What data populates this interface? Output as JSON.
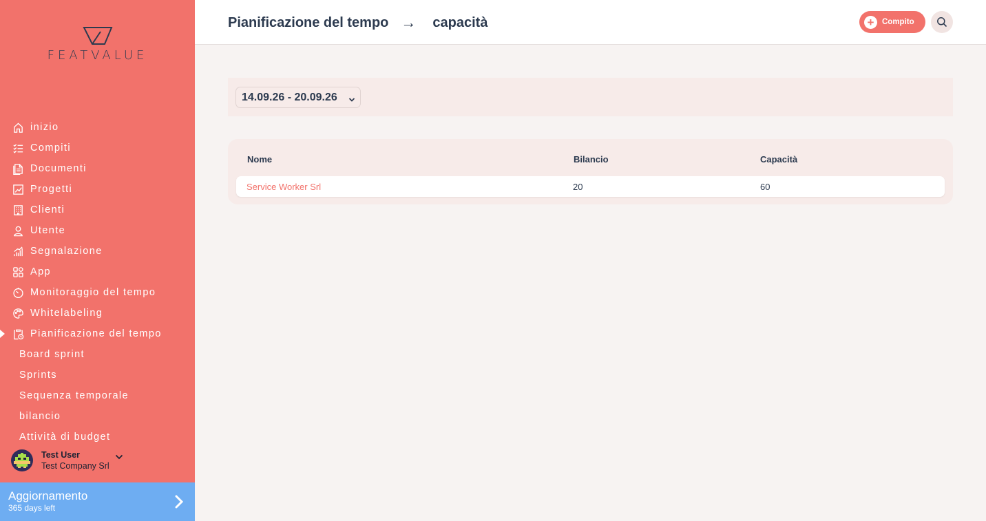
{
  "app": {
    "logo_text": "FEATVALUE"
  },
  "sidebar": {
    "items": [
      {
        "label": "inizio",
        "icon": "home-icon"
      },
      {
        "label": "Compiti",
        "icon": "checklist-icon"
      },
      {
        "label": "Documenti",
        "icon": "document-icon"
      },
      {
        "label": "Progetti",
        "icon": "chart-board-icon"
      },
      {
        "label": "Clienti",
        "icon": "building-icon"
      },
      {
        "label": "Utente",
        "icon": "user-icon"
      },
      {
        "label": "Segnalazione",
        "icon": "bar-chart-icon"
      },
      {
        "label": "App",
        "icon": "apps-icon"
      },
      {
        "label": "Monitoraggio del tempo",
        "icon": "timer-icon"
      },
      {
        "label": "Whitelabeling",
        "icon": "palette-icon"
      },
      {
        "label": "Pianificazione del tempo",
        "icon": "clipboard-clock-icon",
        "active": true
      }
    ],
    "sub_items": [
      {
        "label": "Board sprint"
      },
      {
        "label": "Sprints"
      },
      {
        "label": "Sequenza temporale"
      },
      {
        "label": "bilancio"
      },
      {
        "label": "Attività di budget"
      }
    ],
    "user": {
      "name": "Test User",
      "company": "Test Company Srl"
    },
    "upgrade": {
      "title": "Aggiornamento",
      "subtitle": "365 days left"
    }
  },
  "header": {
    "breadcrumb": {
      "parent": "Pianificazione del tempo",
      "separator": "→",
      "current": "capacità"
    },
    "new_task_label": "Compito"
  },
  "filter": {
    "week_range": "14.09.26 - 20.09.26"
  },
  "table": {
    "columns": [
      "Nome",
      "Bilancio",
      "Capacità"
    ],
    "rows": [
      {
        "name": "Service Worker Srl",
        "budget": "20",
        "capacity": "60"
      }
    ]
  },
  "colors": {
    "sidebar_bg": "#f2726b",
    "accent": "#f2726b",
    "upgrade_bg": "#6eadf2",
    "text_dark": "#2c3a4f"
  }
}
